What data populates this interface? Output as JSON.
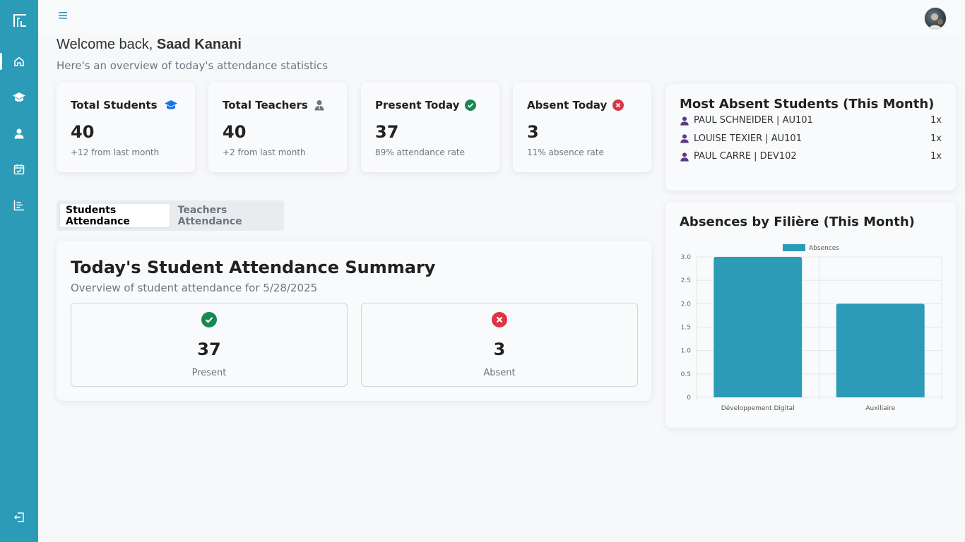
{
  "user": {
    "greeting": "Welcome back,",
    "name": "Saad Kanani"
  },
  "header": {
    "subtitle": "Here's an overview of today's attendance statistics"
  },
  "sidebar": {
    "items": [
      {
        "icon": "home-icon"
      },
      {
        "icon": "graduation-cap-icon"
      },
      {
        "icon": "user-icon"
      },
      {
        "icon": "calendar-check-icon"
      },
      {
        "icon": "bar-chart-icon"
      }
    ],
    "logout_icon": "logout-icon"
  },
  "stats": [
    {
      "title": "Total Students",
      "value": "40",
      "sub": "+12 from last month",
      "icon": "graduation-cap-icon",
      "icon_color": "#1a73e8"
    },
    {
      "title": "Total Teachers",
      "value": "40",
      "sub": "+2 from last month",
      "icon": "teacher-icon",
      "icon_color": "#6c757d"
    },
    {
      "title": "Present Today",
      "value": "37",
      "sub": "89% attendance rate",
      "icon": "check-circle-icon",
      "icon_color": "#198754"
    },
    {
      "title": "Absent Today",
      "value": "3",
      "sub": "11% absence rate",
      "icon": "x-circle-icon",
      "icon_color": "#dc3545"
    }
  ],
  "tabs": [
    {
      "label": "Students Attendance",
      "active": true
    },
    {
      "label": "Teachers Attendance",
      "active": false
    }
  ],
  "summary": {
    "title": "Today's Student Attendance Summary",
    "subtitle": "Overview of student attendance for 5/28/2025",
    "present": {
      "value": "37",
      "label": "Present"
    },
    "absent": {
      "value": "3",
      "label": "Absent"
    }
  },
  "most_absent": {
    "title": "Most Absent Students (This Month)",
    "students": [
      {
        "name": "PAUL SCHNEIDER | AU101",
        "count": "1x"
      },
      {
        "name": "LOUISE TEXIER | AU101",
        "count": "1x"
      },
      {
        "name": "PAUL CARRE | DEV102",
        "count": "1x"
      }
    ]
  },
  "colors": {
    "accent": "#2b9bb7",
    "bar": "#2b9bb7",
    "present": "#198754",
    "absent": "#dc3545",
    "user_icon": "#5b3a86"
  },
  "chart_data": {
    "type": "bar",
    "title": "Absences by Filière (This Month)",
    "categories": [
      "Développement Digital",
      "Auxiliaire"
    ],
    "series": [
      {
        "name": "Absences",
        "values": [
          3,
          2
        ]
      }
    ],
    "ylim": [
      0,
      3
    ],
    "yticks": [
      "0",
      "0.5",
      "1.0",
      "1.5",
      "2.0",
      "2.5",
      "3.0"
    ],
    "legend": "top",
    "grid": true
  }
}
